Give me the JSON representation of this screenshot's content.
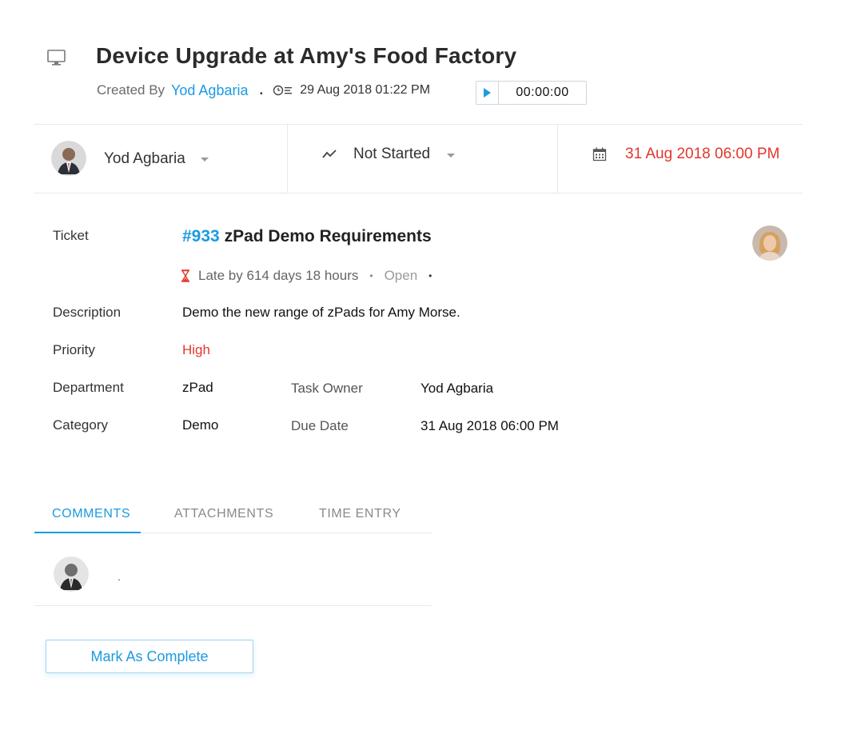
{
  "task": {
    "title": "Device Upgrade at Amy's Food Factory",
    "created_by_label": "Created By",
    "created_by": "Yod Agbaria",
    "separator": ".",
    "created_at": "29 Aug 2018 01:22 PM",
    "timer": "00:00:00"
  },
  "status_bar": {
    "owner": "Yod Agbaria",
    "status": "Not Started",
    "due": "31 Aug 2018 06:00 PM"
  },
  "details": {
    "ticket_label": "Ticket",
    "ticket_number": "#933",
    "ticket_subject": "zPad Demo Requirements",
    "late_text": "Late by 614 days 18 hours",
    "ticket_status": "Open",
    "description_label": "Description",
    "description": "Demo the new range of zPads for Amy Morse.",
    "priority_label": "Priority",
    "priority": "High",
    "department_label": "Department",
    "department": "zPad",
    "task_owner_label": "Task Owner",
    "task_owner": "Yod Agbaria",
    "category_label": "Category",
    "category": "Demo",
    "due_date_label": "Due Date",
    "due_date": "31 Aug 2018 06:00 PM"
  },
  "tabs": [
    {
      "label": "COMMENTS",
      "active": true
    },
    {
      "label": "ATTACHMENTS",
      "active": false
    },
    {
      "label": "TIME ENTRY",
      "active": false
    }
  ],
  "comment": {
    "placeholder": "."
  },
  "actions": {
    "mark_complete": "Mark As Complete"
  },
  "colors": {
    "accent": "#1b9be0",
    "danger": "#e2372b"
  },
  "icons": [
    "monitor-icon",
    "clock-list-icon",
    "play-icon",
    "trend-icon",
    "calendar-icon",
    "hourglass-icon",
    "caret-down-icon"
  ]
}
